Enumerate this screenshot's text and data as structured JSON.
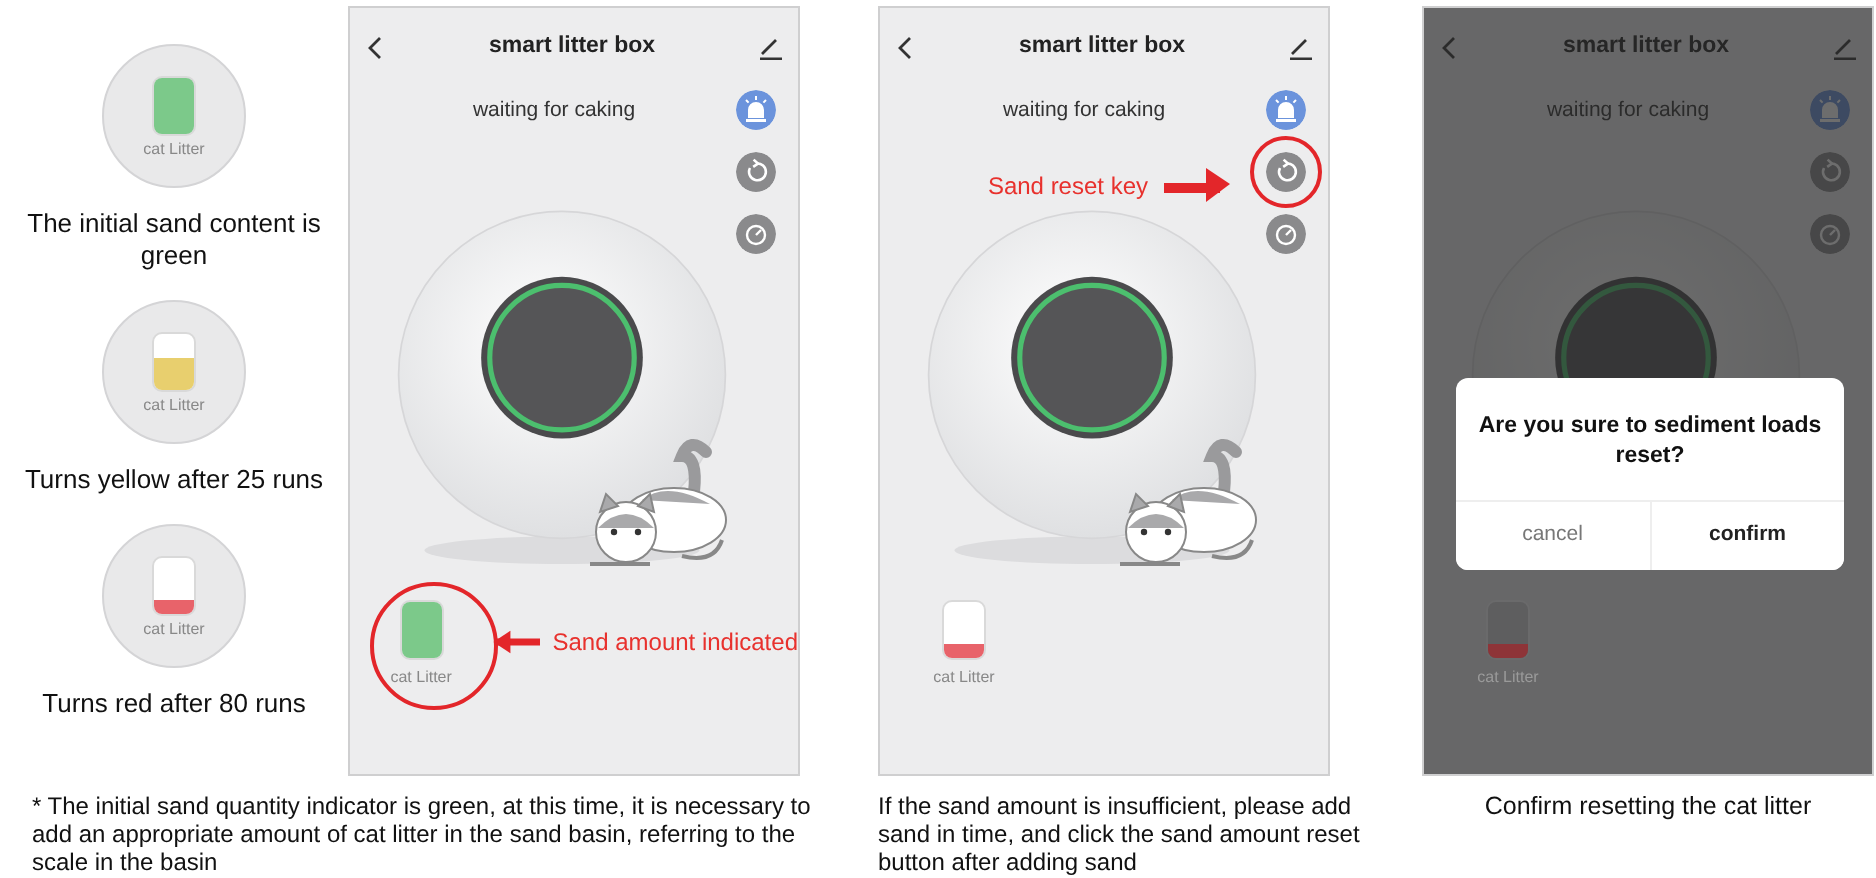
{
  "legend": [
    {
      "label": "cat Litter",
      "level": 1,
      "color": "#7cc98a",
      "caption": "The initial sand content is green"
    },
    {
      "label": "cat Litter",
      "level": 0.55,
      "color": "#e8cf6e",
      "caption": "Turns yellow after 25 runs"
    },
    {
      "label": "cat Litter",
      "level": 0.25,
      "color": "#e8636a",
      "caption": "Turns red after 80 runs"
    }
  ],
  "screens": [
    {
      "title": "smart litter box",
      "status": "waiting for caking",
      "dimmed": false,
      "indicator": {
        "label": "cat Litter",
        "level": 1,
        "color": "#7cc98a"
      },
      "callout": {
        "kind": "indicator",
        "text": "Sand amount indicated"
      },
      "caption": "* The initial sand quantity indicator is green, at this time, it is necessary to add an appropriate amount of cat litter in the sand basin, referring to the scale in the basin"
    },
    {
      "title": "smart litter box",
      "status": "waiting for caking",
      "dimmed": false,
      "indicator": {
        "label": "cat Litter",
        "level": 0.25,
        "color": "#e8636a"
      },
      "callout": {
        "kind": "reset_key",
        "text": "Sand reset key"
      },
      "caption": "If the sand amount is insufficient, please add sand in time, and click the sand amount reset button after adding sand"
    },
    {
      "title": "smart litter box",
      "status": "waiting for caking",
      "dimmed": true,
      "indicator": {
        "label": "cat Litter",
        "level": 0.25,
        "color": "#8e3438"
      },
      "dialog": {
        "message": "Are you sure to sediment loads reset?",
        "buttons": [
          {
            "label": "cancel",
            "primary": false
          },
          {
            "label": "confirm",
            "primary": true
          }
        ]
      },
      "caption": "Confirm resetting the cat litter"
    }
  ]
}
